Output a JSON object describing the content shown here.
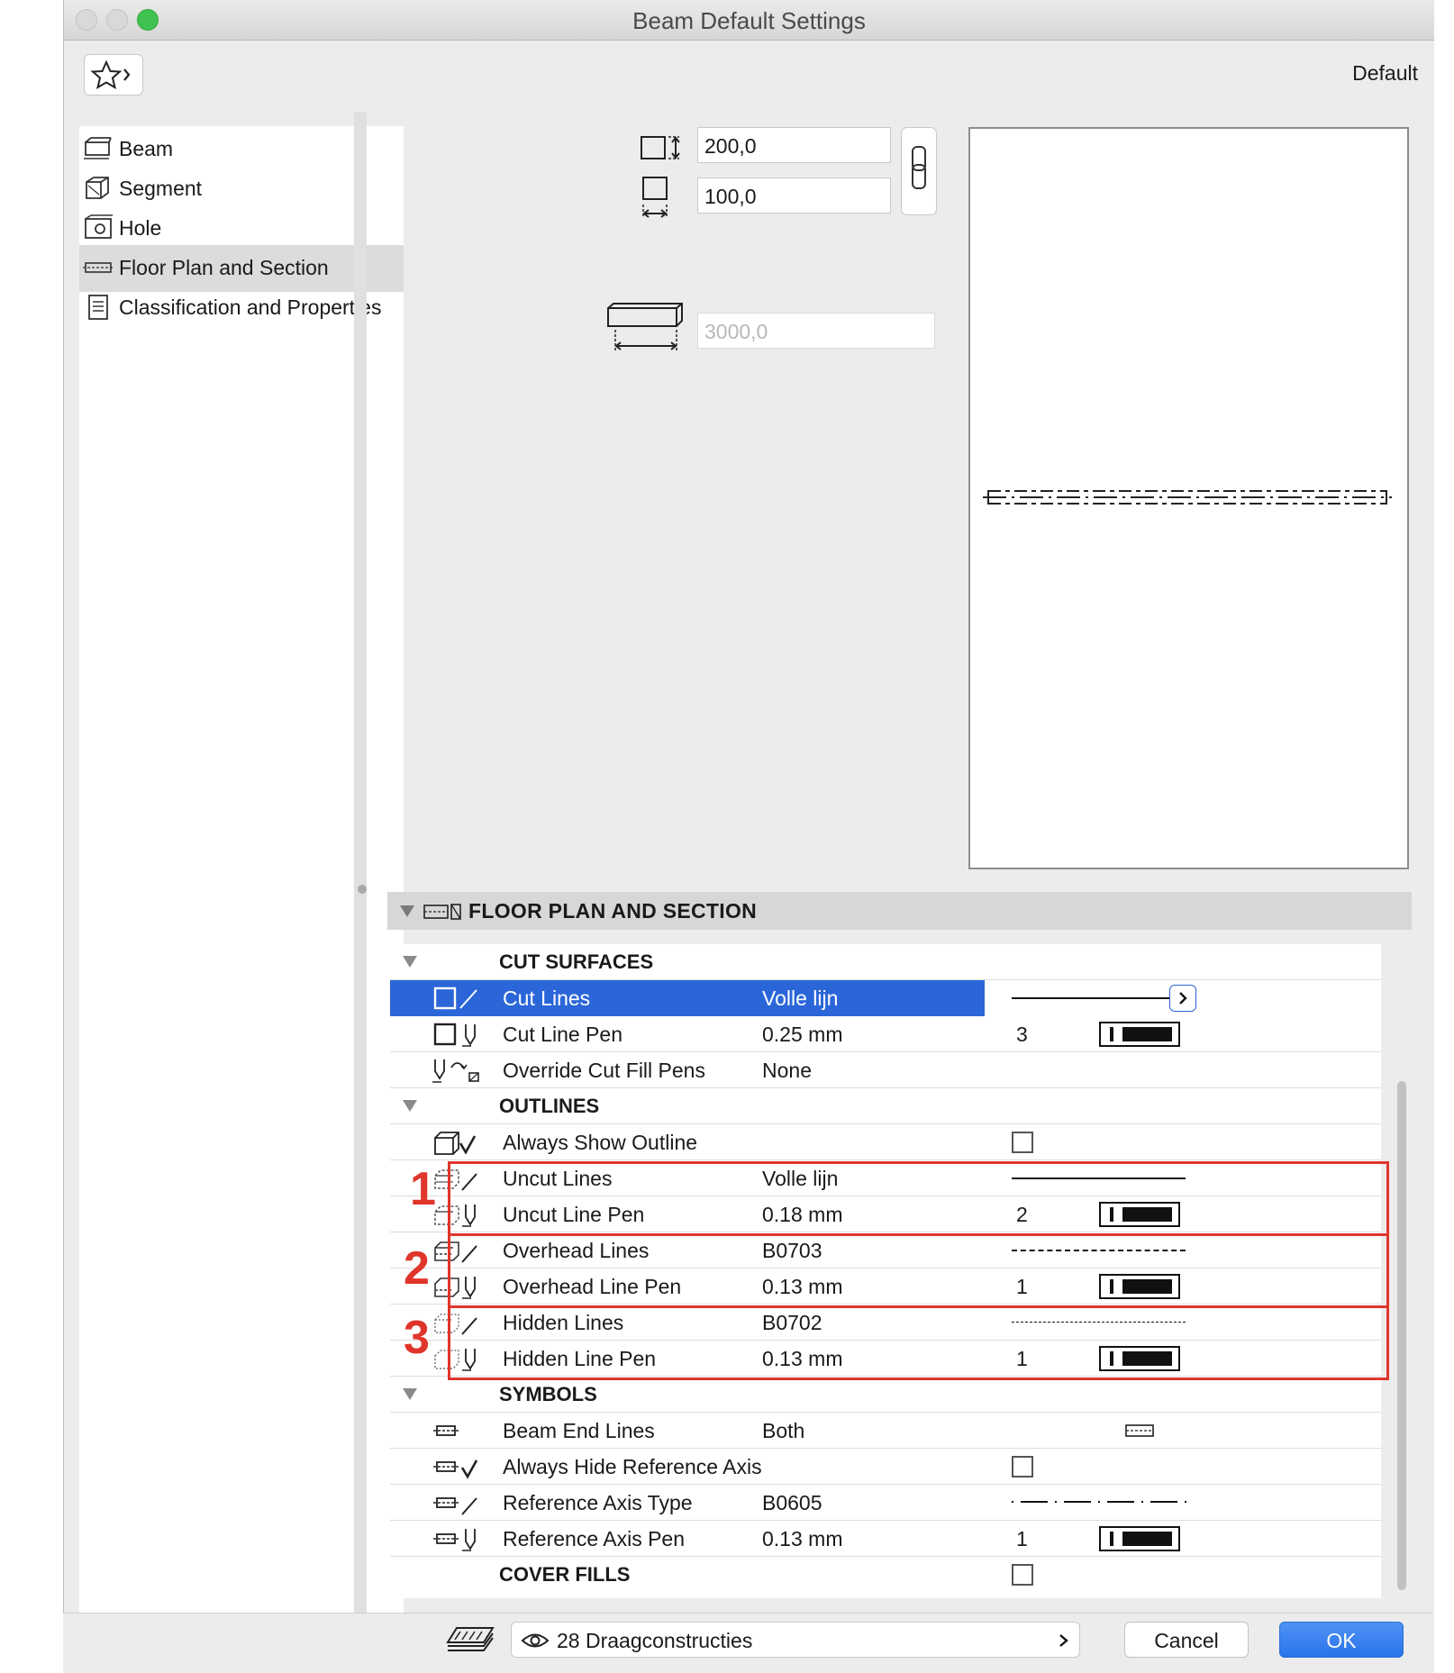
{
  "window": {
    "title": "Beam Default Settings",
    "favorites_label": "Default"
  },
  "sidebar": {
    "items": [
      {
        "label": "Beam",
        "icon": "beam-icon"
      },
      {
        "label": "Segment",
        "icon": "segment-icon"
      },
      {
        "label": "Hole",
        "icon": "hole-icon"
      },
      {
        "label": "Floor Plan and Section",
        "icon": "floor-plan-section-icon",
        "active": true
      },
      {
        "label": "Classification and Properties",
        "icon": "classification-icon"
      }
    ]
  },
  "geometry": {
    "height_value": "200,0",
    "width_value": "100,0",
    "length_value": "3000,0"
  },
  "panel": {
    "title": "FLOOR PLAN AND SECTION",
    "sections": {
      "cut_surfaces": "CUT SURFACES",
      "outlines": "OUTLINES",
      "symbols": "SYMBOLS",
      "cover_fills": "COVER FILLS"
    },
    "rows": {
      "cut_lines": {
        "name": "Cut Lines",
        "value": "Volle lijn"
      },
      "cut_line_pen": {
        "name": "Cut Line Pen",
        "value": "0.25 mm",
        "pen": "3"
      },
      "override_cut_fill_pens": {
        "name": "Override Cut Fill Pens",
        "value": "None"
      },
      "always_show_outline": {
        "name": "Always Show Outline",
        "checked": false
      },
      "uncut_lines": {
        "name": "Uncut Lines",
        "value": "Volle lijn"
      },
      "uncut_line_pen": {
        "name": "Uncut Line Pen",
        "value": "0.18 mm",
        "pen": "2"
      },
      "overhead_lines": {
        "name": "Overhead Lines",
        "value": "B0703"
      },
      "overhead_line_pen": {
        "name": "Overhead Line Pen",
        "value": "0.13 mm",
        "pen": "1"
      },
      "hidden_lines": {
        "name": "Hidden Lines",
        "value": "B0702"
      },
      "hidden_line_pen": {
        "name": "Hidden Line Pen",
        "value": "0.13 mm",
        "pen": "1"
      },
      "beam_end_lines": {
        "name": "Beam End Lines",
        "value": "Both"
      },
      "always_hide_reference_axis": {
        "name": "Always Hide Reference Axis",
        "checked": false
      },
      "reference_axis_type": {
        "name": "Reference Axis Type",
        "value": "B0605"
      },
      "reference_axis_pen": {
        "name": "Reference Axis Pen",
        "value": "0.13 mm",
        "pen": "1"
      }
    }
  },
  "annotations": {
    "one": "1",
    "two": "2",
    "three": "3",
    "color": "#e0352b"
  },
  "footer": {
    "layer": "28 Draagconstructies",
    "cancel": "Cancel",
    "ok": "OK"
  },
  "colors": {
    "selection": "#2b66d9",
    "ok_button": "#2a74ea"
  }
}
